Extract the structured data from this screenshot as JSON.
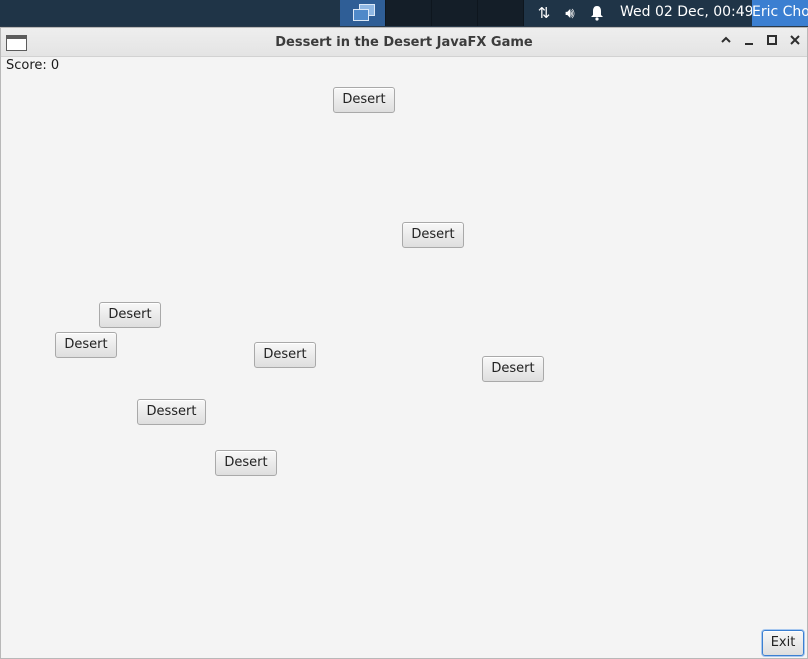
{
  "panel": {
    "workspaces": [
      "workspace-1",
      "workspace-2",
      "workspace-3",
      "workspace-4"
    ],
    "tray_icons": [
      "network-icon",
      "volume-icon",
      "notification-bell-icon"
    ],
    "clock": "Wed 02 Dec, 00:49",
    "user": "Eric Choi"
  },
  "window": {
    "title": "Dessert in the Desert JavaFX Game",
    "controls": [
      "shade-icon",
      "minimize-icon",
      "maximize-icon",
      "close-icon"
    ]
  },
  "game": {
    "score_label": "Score: 0",
    "buttons": [
      {
        "label": "Desert"
      },
      {
        "label": "Desert"
      },
      {
        "label": "Desert"
      },
      {
        "label": "Desert"
      },
      {
        "label": "Desert"
      },
      {
        "label": "Desert"
      },
      {
        "label": "Dessert"
      },
      {
        "label": "Desert"
      }
    ],
    "exit_label": "Exit"
  },
  "colors": {
    "panel": "#1f3447",
    "active_workspace": "#2f5e96",
    "user_menu": "#3b7fd1",
    "window_bg": "#f4f4f4",
    "focus_ring": "#3b7fd1"
  }
}
